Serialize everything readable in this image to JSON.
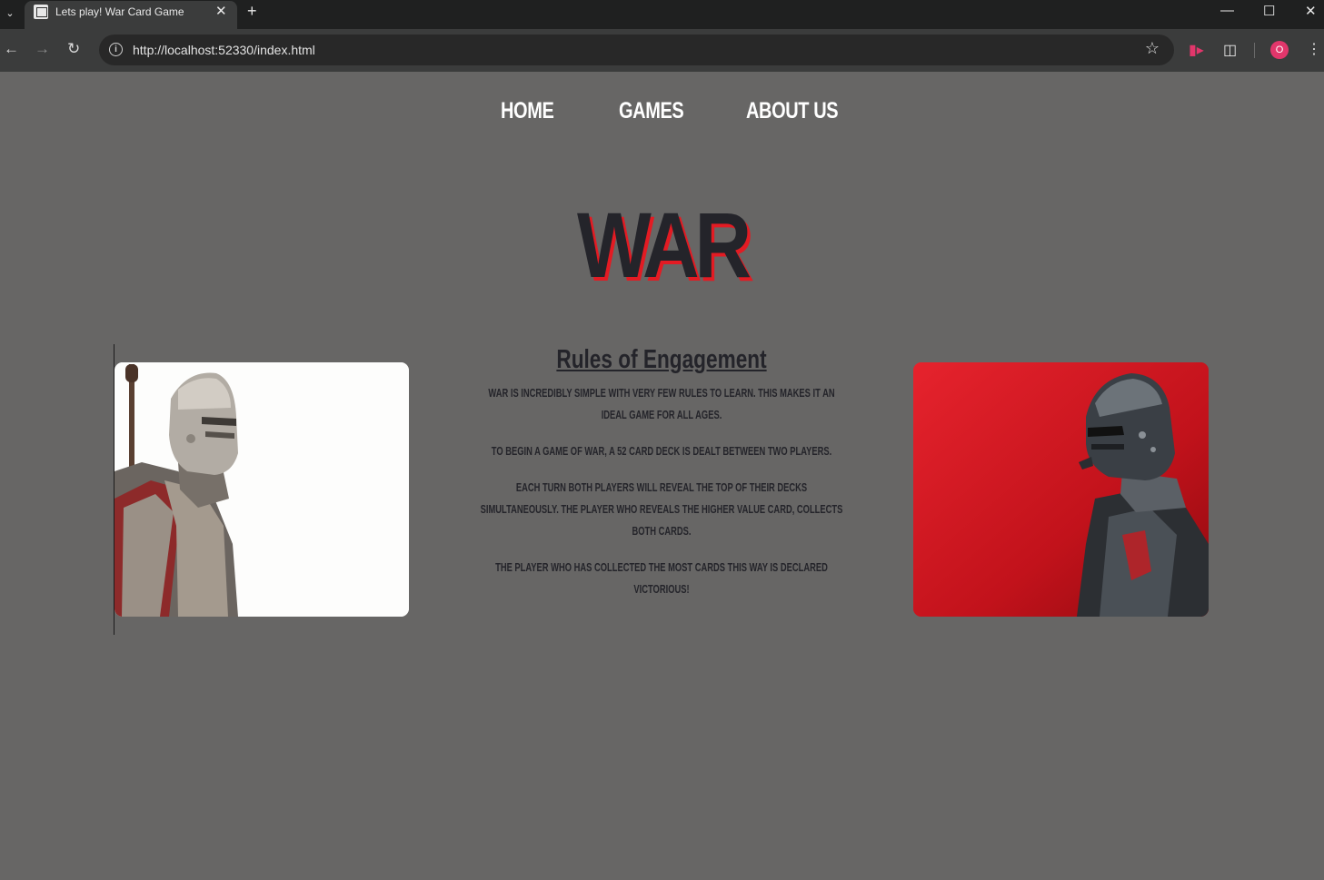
{
  "browser": {
    "tab_title": "Lets play! War Card Game",
    "url": "http://localhost:52330/index.html",
    "profile_initial": "O"
  },
  "nav": {
    "items": [
      {
        "label": "HOME"
      },
      {
        "label": "GAMES"
      },
      {
        "label": "ABOUT US"
      }
    ]
  },
  "hero": {
    "title": "WAR"
  },
  "rules": {
    "heading": "Rules of Engagement",
    "paragraphs": [
      "War is incredibly simple with very few rules to learn. This makes it an ideal game for all ages.",
      "To begin a game of War, a 52 card deck is dealt between two players.",
      "Each turn both players will reveal the top of their decks simultaneously. The player who reveals the higher value card, collects both cards.",
      "The player who has collected the most cards this way is declared victorious!"
    ]
  },
  "colors": {
    "page_background": "#676665",
    "title_text": "#24242a",
    "title_shadow": "#e31b23",
    "nav_text": "#ffffff"
  }
}
